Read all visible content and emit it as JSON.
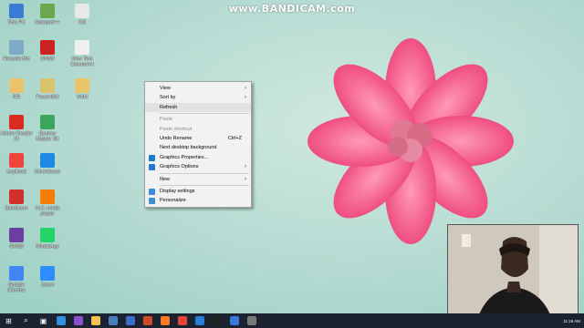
{
  "watermark": "www.BANDICAM.com",
  "desktop_icons": [
    {
      "label": "This PC",
      "icon": "computer-icon",
      "color": "#3a7bd5"
    },
    {
      "label": "Notepad++",
      "icon": "notepad-plus-icon",
      "color": "#6aa84f"
    },
    {
      "label": "Kill",
      "icon": "folder-icon",
      "color": "#e8e8e8"
    },
    {
      "label": "Recycle Bin",
      "icon": "recycle-bin-icon",
      "color": "#7fa9c9"
    },
    {
      "label": "GNS3",
      "icon": "gns3-icon",
      "color": "#cc2222"
    },
    {
      "label": "New Text Document",
      "icon": "text-document-icon",
      "color": "#f0f0f0"
    },
    {
      "label": "RR",
      "icon": "folder-icon",
      "color": "#e9c46a"
    },
    {
      "label": "PowerISO",
      "icon": "poweriso-icon",
      "color": "#d9c36b"
    },
    {
      "label": "VGM",
      "icon": "folder-icon",
      "color": "#e9c46a"
    },
    {
      "label": "Adobe Reader XI",
      "icon": "adobe-reader-icon",
      "color": "#d62d20"
    },
    {
      "label": "Epubsy Master Kit",
      "icon": "epubsy-icon",
      "color": "#3ba55d"
    },
    {
      "label": "AnyDesk",
      "icon": "anydesk-icon",
      "color": "#ef443b"
    },
    {
      "label": "UltraViewer",
      "icon": "ultraviewer-icon",
      "color": "#1e88e5"
    },
    {
      "label": "Bandicam",
      "icon": "bandicam-icon",
      "color": "#d32f2f"
    },
    {
      "label": "VLC media player",
      "icon": "vlc-icon",
      "color": "#f57c00"
    },
    {
      "label": "GNS3",
      "icon": "gns3-purple-icon",
      "color": "#6a3fa0"
    },
    {
      "label": "WhatsApp",
      "icon": "whatsapp-icon",
      "color": "#25d366"
    },
    {
      "label": "Google Chrome",
      "icon": "chrome-icon",
      "color": "#4285f4"
    },
    {
      "label": "Zoom",
      "icon": "zoom-icon",
      "color": "#2d8cff"
    }
  ],
  "context_menu": {
    "items": [
      {
        "label": "View",
        "submenu": true,
        "disabled": false
      },
      {
        "label": "Sort by",
        "submenu": true,
        "disabled": false
      },
      {
        "label": "Refresh",
        "submenu": false,
        "disabled": false,
        "hover": true
      },
      {
        "separator": true
      },
      {
        "label": "Paste",
        "submenu": false,
        "disabled": true
      },
      {
        "label": "Paste shortcut",
        "submenu": false,
        "disabled": true
      },
      {
        "label": "Undo Rename",
        "shortcut": "Ctrl+Z",
        "submenu": false,
        "disabled": false
      },
      {
        "label": "Next desktop background",
        "submenu": false,
        "disabled": false
      },
      {
        "label": "Graphics Properties...",
        "submenu": false,
        "disabled": false,
        "icon": "intel-graphics-icon"
      },
      {
        "label": "Graphics Options",
        "submenu": true,
        "disabled": false,
        "icon": "intel-graphics-icon"
      },
      {
        "separator": true
      },
      {
        "label": "New",
        "submenu": true,
        "disabled": false
      },
      {
        "separator": true
      },
      {
        "label": "Display settings",
        "submenu": false,
        "disabled": false,
        "icon": "display-icon"
      },
      {
        "label": "Personalize",
        "submenu": false,
        "disabled": false,
        "icon": "personalize-icon"
      }
    ]
  },
  "taskbar": {
    "apps": [
      {
        "icon": "start-icon"
      },
      {
        "icon": "search-icon"
      },
      {
        "icon": "task-view-icon"
      },
      {
        "icon": "edge-icon"
      },
      {
        "icon": "visual-studio-icon"
      },
      {
        "icon": "file-explorer-icon"
      },
      {
        "icon": "network-icon"
      },
      {
        "icon": "store-icon"
      },
      {
        "icon": "powerpoint-icon"
      },
      {
        "icon": "xampp-icon"
      },
      {
        "icon": "chrome-icon"
      },
      {
        "icon": "photos-icon"
      },
      {
        "icon": "cmd-icon"
      },
      {
        "icon": "mail-icon"
      },
      {
        "icon": "settings-icon"
      }
    ],
    "tray_time": "11:16 AM"
  }
}
